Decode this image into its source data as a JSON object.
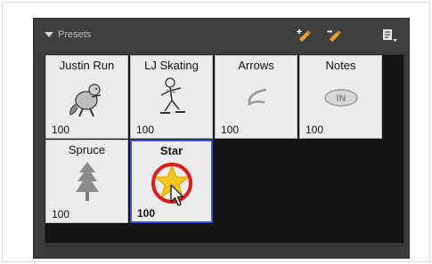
{
  "panel": {
    "title": "Presets"
  },
  "presets": [
    {
      "name": "Justin Run",
      "size": "100",
      "icon": "beaver-running-icon"
    },
    {
      "name": "LJ Skating",
      "size": "100",
      "icon": "skater-icon"
    },
    {
      "name": "Arrows",
      "size": "100",
      "icon": "arrow-stroke-icon"
    },
    {
      "name": "Notes",
      "size": "100",
      "icon": "notes-bubble-icon"
    },
    {
      "name": "Spruce",
      "size": "100",
      "icon": "spruce-tree-icon"
    },
    {
      "name": "Star",
      "size": "100",
      "icon": "star-icon",
      "selected": true
    }
  ],
  "colors": {
    "panel_bg": "#3c3c3c",
    "grid_bg": "#141414",
    "cell_bg": "#ececec",
    "selection_border": "#3a4ff0",
    "highlight_circle": "#e01b1b",
    "star_fill": "#f5c518"
  }
}
